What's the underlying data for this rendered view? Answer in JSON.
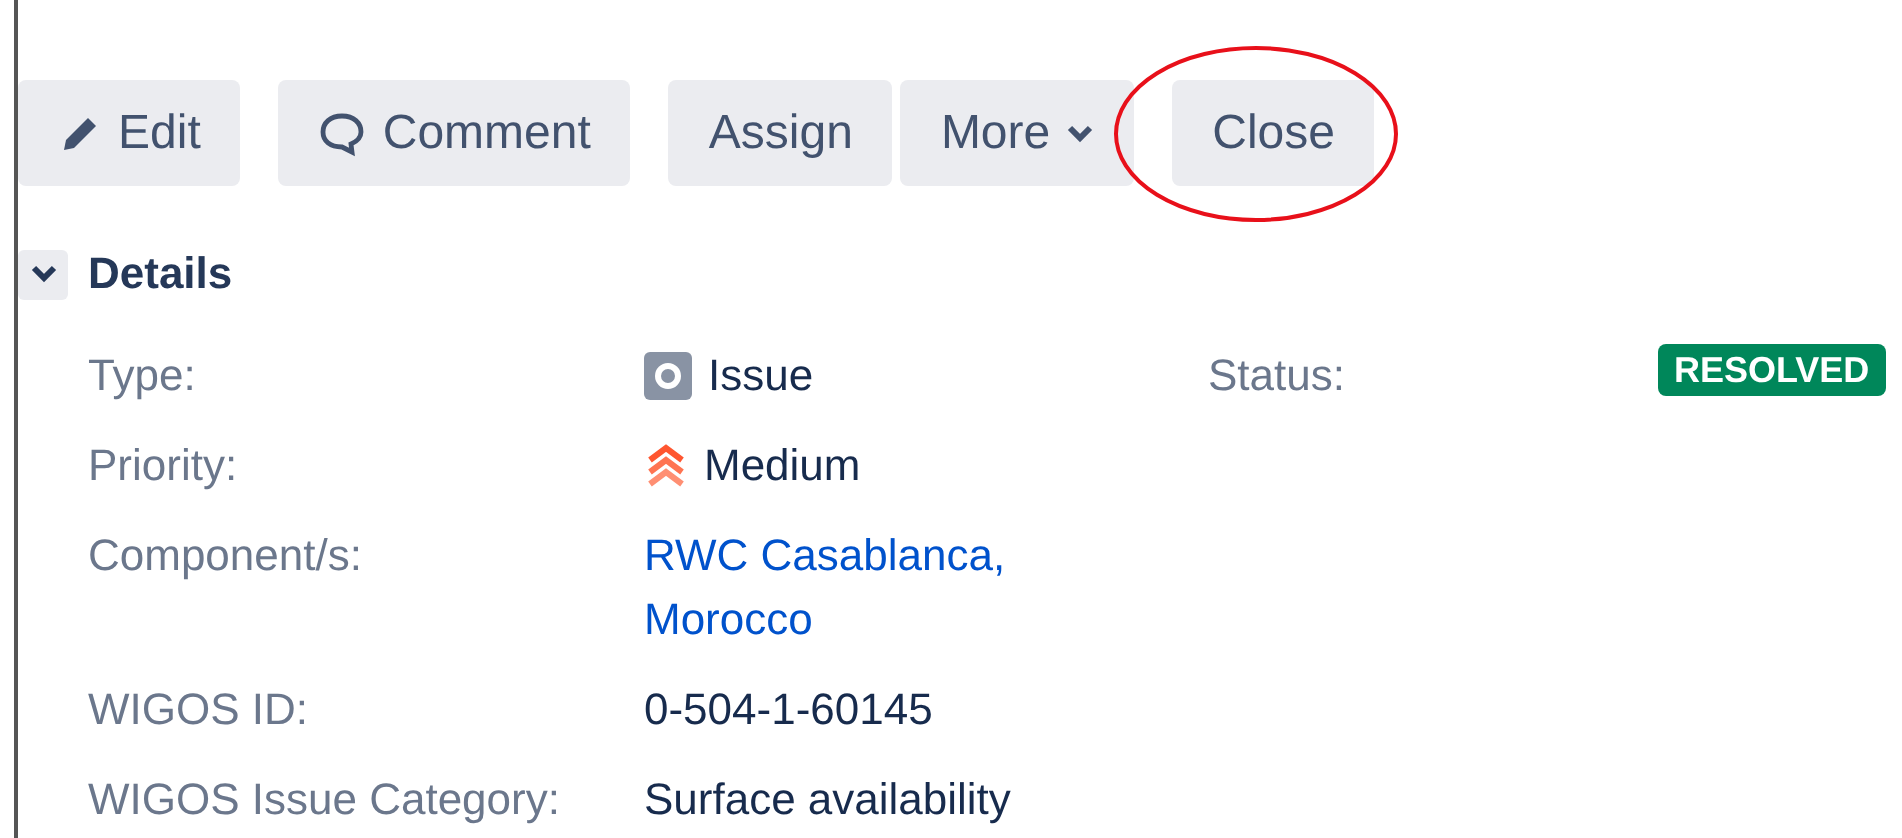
{
  "toolbar": [
    [
      {
        "label": "Edit",
        "kind": "edit",
        "highlighted": false
      }
    ],
    [
      {
        "label": "Comment",
        "kind": "comment",
        "highlighted": false
      }
    ],
    [
      {
        "label": "Assign",
        "kind": "plain",
        "highlighted": false
      },
      {
        "label": "More",
        "kind": "dropdown",
        "highlighted": false
      }
    ],
    [
      {
        "label": "Close",
        "kind": "plain",
        "highlighted": true
      }
    ]
  ],
  "details": {
    "title": "Details",
    "expanded": true,
    "fields": [
      {
        "label": "Type:",
        "kind": "type",
        "value": "Issue",
        "side_label": "Status:",
        "side_value": "RESOLVED"
      },
      {
        "label": "Priority:",
        "kind": "priority",
        "value": "Medium"
      },
      {
        "label": "Component/s:",
        "kind": "link",
        "value": "RWC Casablanca, Morocco"
      },
      {
        "label": "WIGOS ID:",
        "kind": "text",
        "value": "0-504-1-60145"
      },
      {
        "label": "WIGOS Issue Category:",
        "kind": "text",
        "value": "Surface availability"
      }
    ]
  }
}
